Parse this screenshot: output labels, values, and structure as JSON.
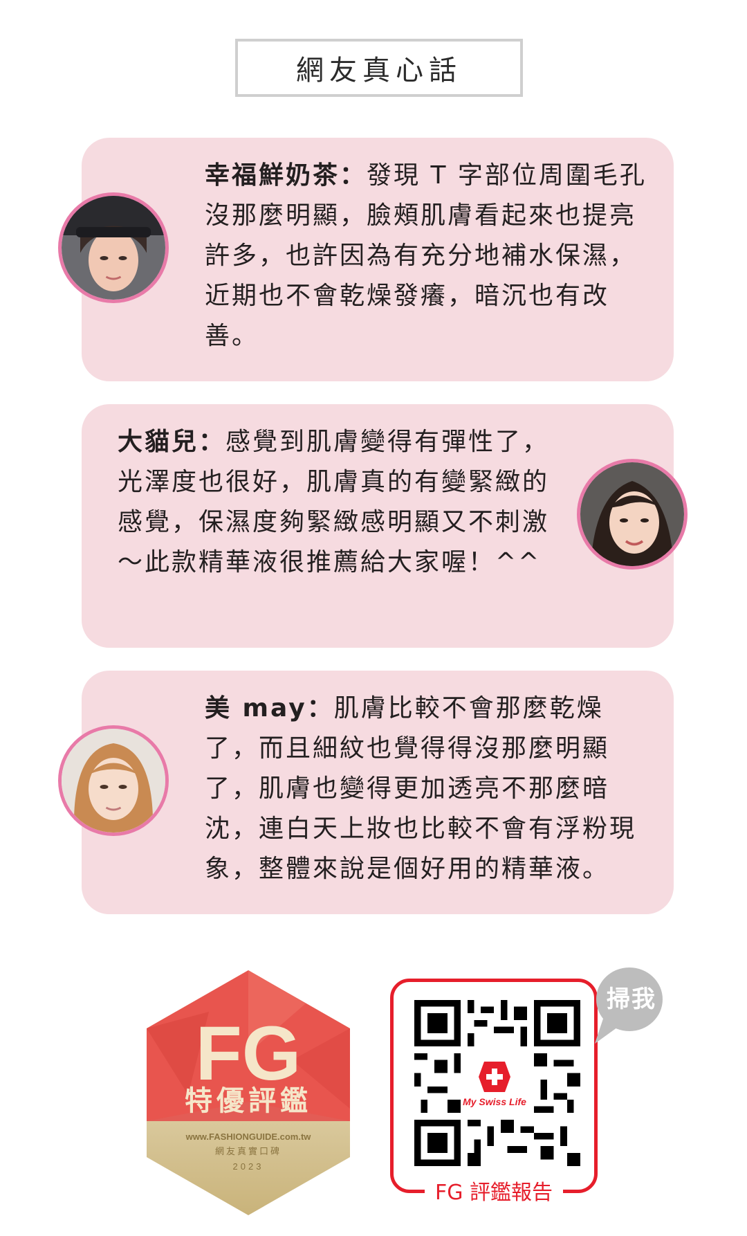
{
  "header": {
    "title": "網友真心話"
  },
  "reviews": [
    {
      "name": "幸福鮮奶茶：",
      "text": "發現 T 字部位周圍毛孔沒那麼明顯，臉頰肌膚看起來也提亮許多，也許因為有充分地補水保濕，近期也不會乾燥發癢，暗沉也有改善。"
    },
    {
      "name": "大貓兒：",
      "text": "感覺到肌膚變得有彈性了，光澤度也很好，肌膚真的有變緊緻的感覺，保濕度夠緊緻感明顯又不刺激～此款精華液很推薦給大家喔！^^"
    },
    {
      "name": "美 may：",
      "text": "肌膚比較不會那麼乾燥了，而且細紋也覺得得沒那麼明顯了，肌膚也變得更加透亮不那麼暗沈，連白天上妝也比較不會有浮粉現象，整體來說是個好用的精華液。"
    }
  ],
  "badge": {
    "logo": "FG",
    "title": "特優評鑑",
    "url": "www.FASHIONGUIDE.com.tw",
    "subtitle": "網友真實口碑",
    "year": "2023"
  },
  "qr": {
    "label": "FG 評鑑報告",
    "brand": "My Swiss Life",
    "bubble": "掃我"
  },
  "colors": {
    "card_bg": "#f6dbe0",
    "avatar_border": "#e87aa8",
    "qr_red": "#e61e2b",
    "badge_red": "#e8554e"
  }
}
